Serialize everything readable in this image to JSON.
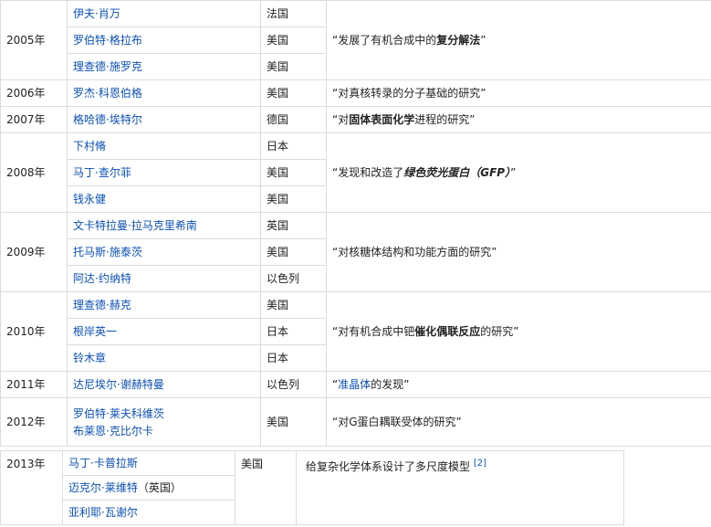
{
  "rows": {
    "y2005": {
      "year": "2005年",
      "laureates": [
        {
          "name": "伊夫·肖万",
          "country": "法国"
        },
        {
          "name": "罗伯特·格拉布",
          "country": "美国"
        },
        {
          "name": "理查德·施罗克",
          "country": "美国"
        }
      ],
      "ach_pre": "“发展了有机合成中的",
      "ach_bold": "复分解法",
      "ach_post": "”"
    },
    "y2006": {
      "year": "2006年",
      "laureates": [
        {
          "name": "罗杰·科恩伯格",
          "country": "美国"
        }
      ],
      "ach": "“对真核转录的分子基础的研究”"
    },
    "y2007": {
      "year": "2007年",
      "laureates": [
        {
          "name": "格哈德·埃特尔",
          "country": "德国"
        }
      ],
      "ach_pre": "“对",
      "ach_bold": "固体表面化学",
      "ach_post": "进程的研究”"
    },
    "y2008": {
      "year": "2008年",
      "laureates": [
        {
          "name": "下村脩",
          "country": "日本"
        },
        {
          "name": "马丁·查尔菲",
          "country": "美国"
        },
        {
          "name": "钱永健",
          "country": "美国"
        }
      ],
      "ach_pre": "“发现和改造了",
      "ach_bold": "绿色荧光蛋白（GFP）",
      "ach_post": "”"
    },
    "y2009": {
      "year": "2009年",
      "laureates": [
        {
          "name": "文卡特拉曼·拉马克里希南",
          "country": "英国"
        },
        {
          "name": "托马斯·施泰茨",
          "country": "美国"
        },
        {
          "name": "阿达·约纳特",
          "country": "以色列"
        }
      ],
      "ach": "“对核糖体结构和功能方面的研究”"
    },
    "y2010": {
      "year": "2010年",
      "laureates": [
        {
          "name": "理查德·赫克",
          "country": "美国"
        },
        {
          "name": "根岸英一",
          "country": "日本"
        },
        {
          "name": "铃木章",
          "country": "日本"
        }
      ],
      "ach_pre": "“对有机合成中钯",
      "ach_bold": "催化偶联反应",
      "ach_post": "的研究”"
    },
    "y2011": {
      "year": "2011年",
      "laureates": [
        {
          "name": "达尼埃尔·谢赫特曼",
          "country": "以色列"
        }
      ],
      "ach_pre": "“",
      "ach_link": "准晶体",
      "ach_post": "的发现”"
    },
    "y2012": {
      "year": "2012年",
      "names": [
        "罗伯特·莱夫科维茨",
        "布莱恩·克比尔卡"
      ],
      "country": "美国",
      "ach": "“对G蛋白耦联受体的研究”"
    },
    "y2013": {
      "year": "2013年",
      "names": [
        "马丁·卡普拉斯",
        "迈克尔·莱维特",
        "亚利耶·瓦谢尔"
      ],
      "name2_suffix": "（英国）",
      "country": "美国",
      "ach": "给复杂化学体系设计了多尺度模型",
      "ref": "[2]"
    }
  }
}
